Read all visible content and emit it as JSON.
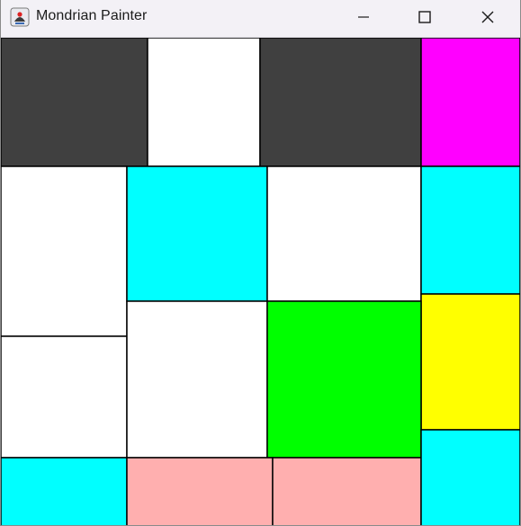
{
  "window": {
    "title": "Mondrian Painter",
    "app_icon": "java-duke-icon",
    "controls": [
      {
        "name": "minimize",
        "icon": "minimize-icon"
      },
      {
        "name": "maximize",
        "icon": "maximize-icon"
      },
      {
        "name": "close",
        "icon": "close-icon"
      }
    ]
  },
  "palette": {
    "dark_gray": "#404040",
    "white": "#ffffff",
    "magenta": "#ff00ff",
    "cyan": "#00ffff",
    "green": "#00ff00",
    "yellow": "#ffff00",
    "pink": "#ffafaf",
    "line": "#000000"
  },
  "canvas_colors_order": [
    "dark_gray",
    "white",
    "dark_gray",
    "magenta",
    "white",
    "cyan",
    "white",
    "cyan",
    "white",
    "yellow",
    "white",
    "green",
    "white",
    "cyan",
    "pink",
    "pink",
    "cyan"
  ]
}
